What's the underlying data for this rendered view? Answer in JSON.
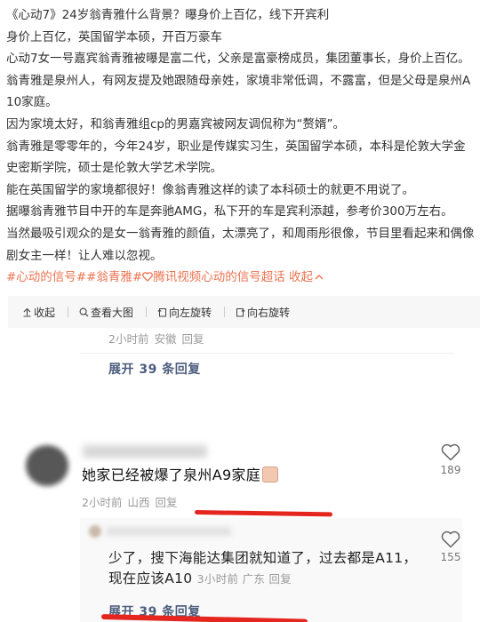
{
  "post": {
    "lines": [
      "《心动7》24岁翁青雅什么背景？曝身价上百亿，线下开宾利",
      "身价上百亿，英国留学本硕，开百万豪车",
      "心动7女一号嘉宾翁青雅被曝是富二代，父亲是富豪榜成员，集团董事长，身价上百亿。",
      "翁青雅是泉州人，有网友提及她跟随母亲姓，家境非常低调，不露富，但是父母是泉州A10家庭。",
      "因为家境太好，和翁青雅组cp的男嘉宾被网友调侃称为“赘婿”。",
      "翁青雅是零零年的，今年24岁，职业是传媒实习生，英国留学本硕，本科是伦敦大学金史密斯学院，硕士是伦敦大学艺术学院。",
      "能在英国留学的家境都很好！像翁青雅这样的读了本科硕士的就更不用说了。",
      "据曝翁青雅节目中开的车是奔驰AMG，私下开的车是宾利添越，参考价300万左右。",
      "当然最吸引观众的是女一翁青雅的颜值，太漂亮了，和周雨彤很像，节目里看起来和偶像剧女主一样！让人难以忽视。"
    ],
    "tags": {
      "tag1": "#心动的信号#",
      "tag2": "#翁青雅#",
      "tag3": "腾讯视频心动的信号超话",
      "collapse": "收起"
    }
  },
  "toolbar": {
    "collapse": "收起",
    "view_large": "查看大图",
    "rotate_left": "向左旋转",
    "rotate_right": "向右旋转"
  },
  "comments": {
    "top_meta": {
      "time": "2小时前",
      "location": "安徽",
      "reply": "回复"
    },
    "top_expand": "展开 39 条回复",
    "comment": {
      "text": "她家已经被爆了泉州A9家庭",
      "time": "2小时前",
      "location": "山西",
      "reply": "回复",
      "likes": "189"
    },
    "reply": {
      "text": "少了，搜下海能达集团就知道了，过去都是A11，现在应该A10",
      "time": "3小时前",
      "location": "广东",
      "reply": "回复",
      "likes": "155",
      "expand": "展开 39 条回复"
    }
  },
  "colors": {
    "tag": "#eb7350",
    "expand": "#4d5d7d",
    "annotation": "#e4261f"
  }
}
